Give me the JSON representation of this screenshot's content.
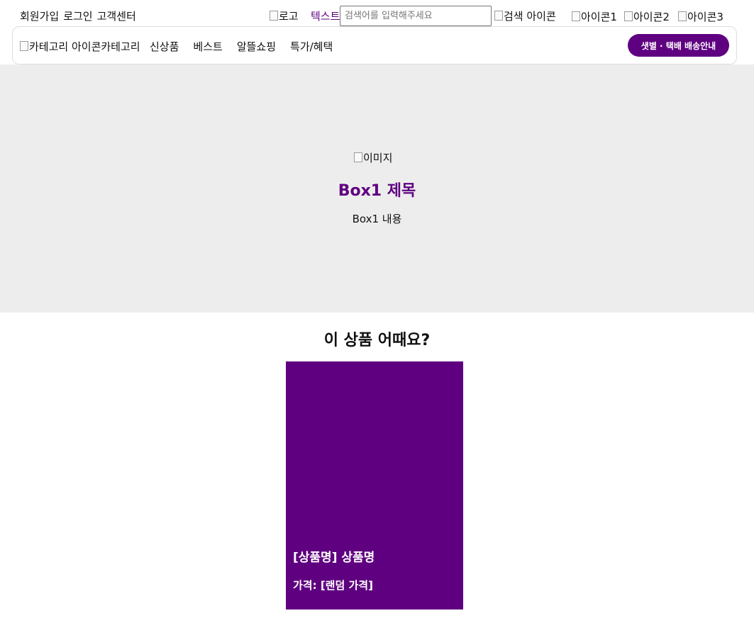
{
  "header": {
    "top_links": [
      "회원가입",
      "로그인",
      "고객센터"
    ],
    "logo_alt": "로고",
    "brand_text": "텍스트",
    "search": {
      "placeholder": "검색어를 입력해주세요",
      "value": ""
    },
    "search_icon_alt": "검색 아이콘",
    "icons": [
      "아이콘1",
      "아이콘2",
      "아이콘3"
    ]
  },
  "nav": {
    "category_icon_alt": "카테고리 아이콘",
    "category_label": "카테고리",
    "menu": [
      "신상품",
      "베스트",
      "알뜰쇼핑",
      "특가/혜택"
    ],
    "delivery_button": "샛별 · 택배 배송안내"
  },
  "hero": {
    "image_alt": "이미지",
    "title": "Box1 제목",
    "description": "Box1 내용"
  },
  "recommend": {
    "title": "이 상품 어때요?",
    "product": {
      "name": "[상품명] 상품명",
      "price": "가격: [랜덤 가격]"
    }
  },
  "colors": {
    "brand": "#5f0080",
    "hero_bg": "#ededed"
  }
}
